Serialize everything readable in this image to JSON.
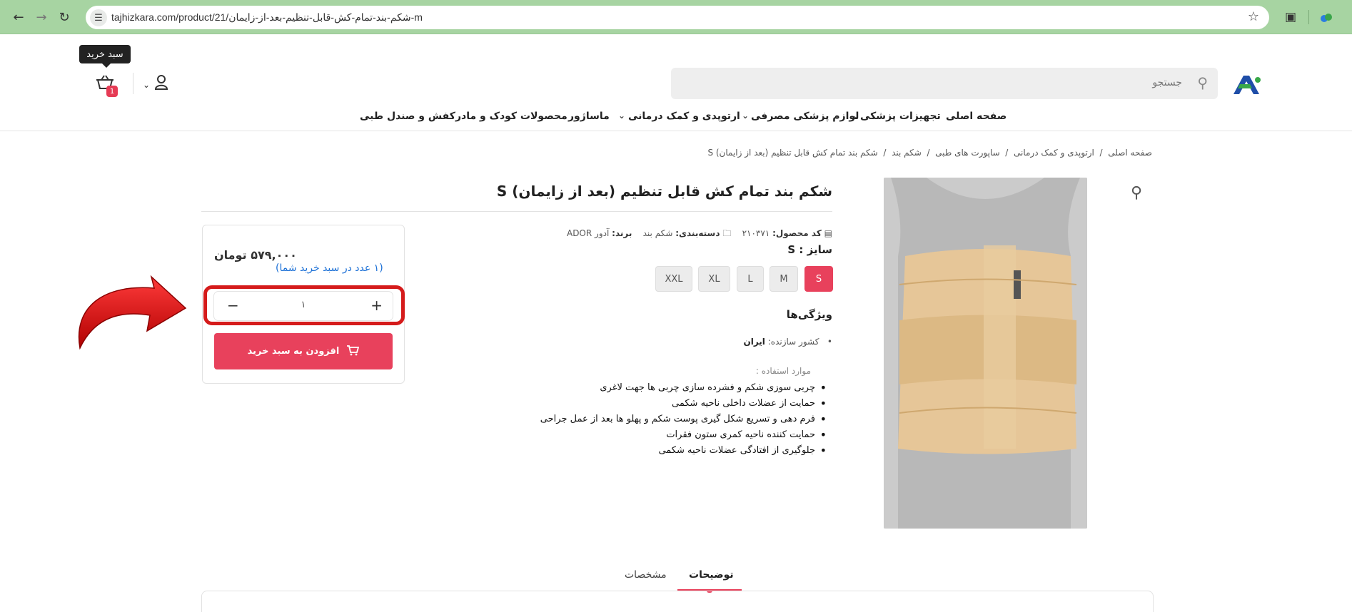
{
  "browser": {
    "url": "tajhizkara.com/product/21/شکم-بند-تمام-کش-قابل-تنظیم-بعد-از-زایمان-m"
  },
  "header": {
    "cart_tooltip": "سبد خرید",
    "cart_count": "1",
    "search_placeholder": "جستجو"
  },
  "menu": {
    "items": [
      "صفحه اصلی",
      "تجهیزات پزشکی",
      "لوازم پزشکی مصرفی",
      "ارتوپدی و کمک درمانی",
      "ماساژور",
      "محصولات کودک و مادر",
      "کفش و صندل طبی"
    ]
  },
  "breadcrumb": {
    "items": [
      "صفحه اصلی",
      "ارتوپدی و کمک درمانی",
      "ساپورت های طبی",
      "شکم بند",
      "شکم بند تمام کش قابل تنظیم (بعد از زایمان) S"
    ]
  },
  "product": {
    "title": "شکم بند تمام کش قابل تنظیم (بعد از زایمان) S",
    "code_label": "کد محصول:",
    "code_value": "۲۱۰۳۷۱",
    "category_label": "دسته‌بندی:",
    "category_value": "شکم بند",
    "brand_label": "برند:",
    "brand_value": "آدور ADOR",
    "size_label": "سایز : S",
    "sizes": [
      "S",
      "M",
      "L",
      "XL",
      "XXL"
    ],
    "selected_size": "S",
    "features_title": "ویژگی‌ها",
    "country_label": "کشور سازنده:",
    "country_value": "ایران",
    "uses_label": "موارد استفاده :",
    "uses": [
      "چربی سوزی شکم و فشرده سازی چربی ها جهت لاغری",
      "حمایت از عضلات داخلی ناحیه شکمی",
      "فرم دهی و تسریع شکل گیری پوست شکم و پهلو ها بعد از عمل جراحی",
      "حمایت کننده ناحیه کمری ستون فقرات",
      "جلوگیری از افتادگی عضلات ناحیه شکمی"
    ]
  },
  "buy_box": {
    "price": "۵۷۹,۰۰۰ تومان",
    "in_cart": "(۱ عدد در سبد خرید شما)",
    "quantity": "۱",
    "add_button": "افزودن به سبد خرید"
  },
  "tabs": {
    "items": [
      "توضیحات",
      "مشخصات"
    ],
    "active": "توضیحات"
  },
  "colors": {
    "accent": "#e8415c",
    "link": "#1a6fd6",
    "highlight": "#d51b1b",
    "browser_bar": "#a7d4a2"
  },
  "icons": [
    "back-icon",
    "forward-icon",
    "reload-icon",
    "site-info-icon",
    "star-icon",
    "extensions-icon",
    "profile-icon",
    "cart-icon",
    "user-icon",
    "chevron-down-icon",
    "search-icon",
    "zoom-icon",
    "barcode-icon",
    "folder-icon",
    "minus-icon",
    "plus-icon",
    "cart-add-icon",
    "red-arrow-annotation"
  ]
}
